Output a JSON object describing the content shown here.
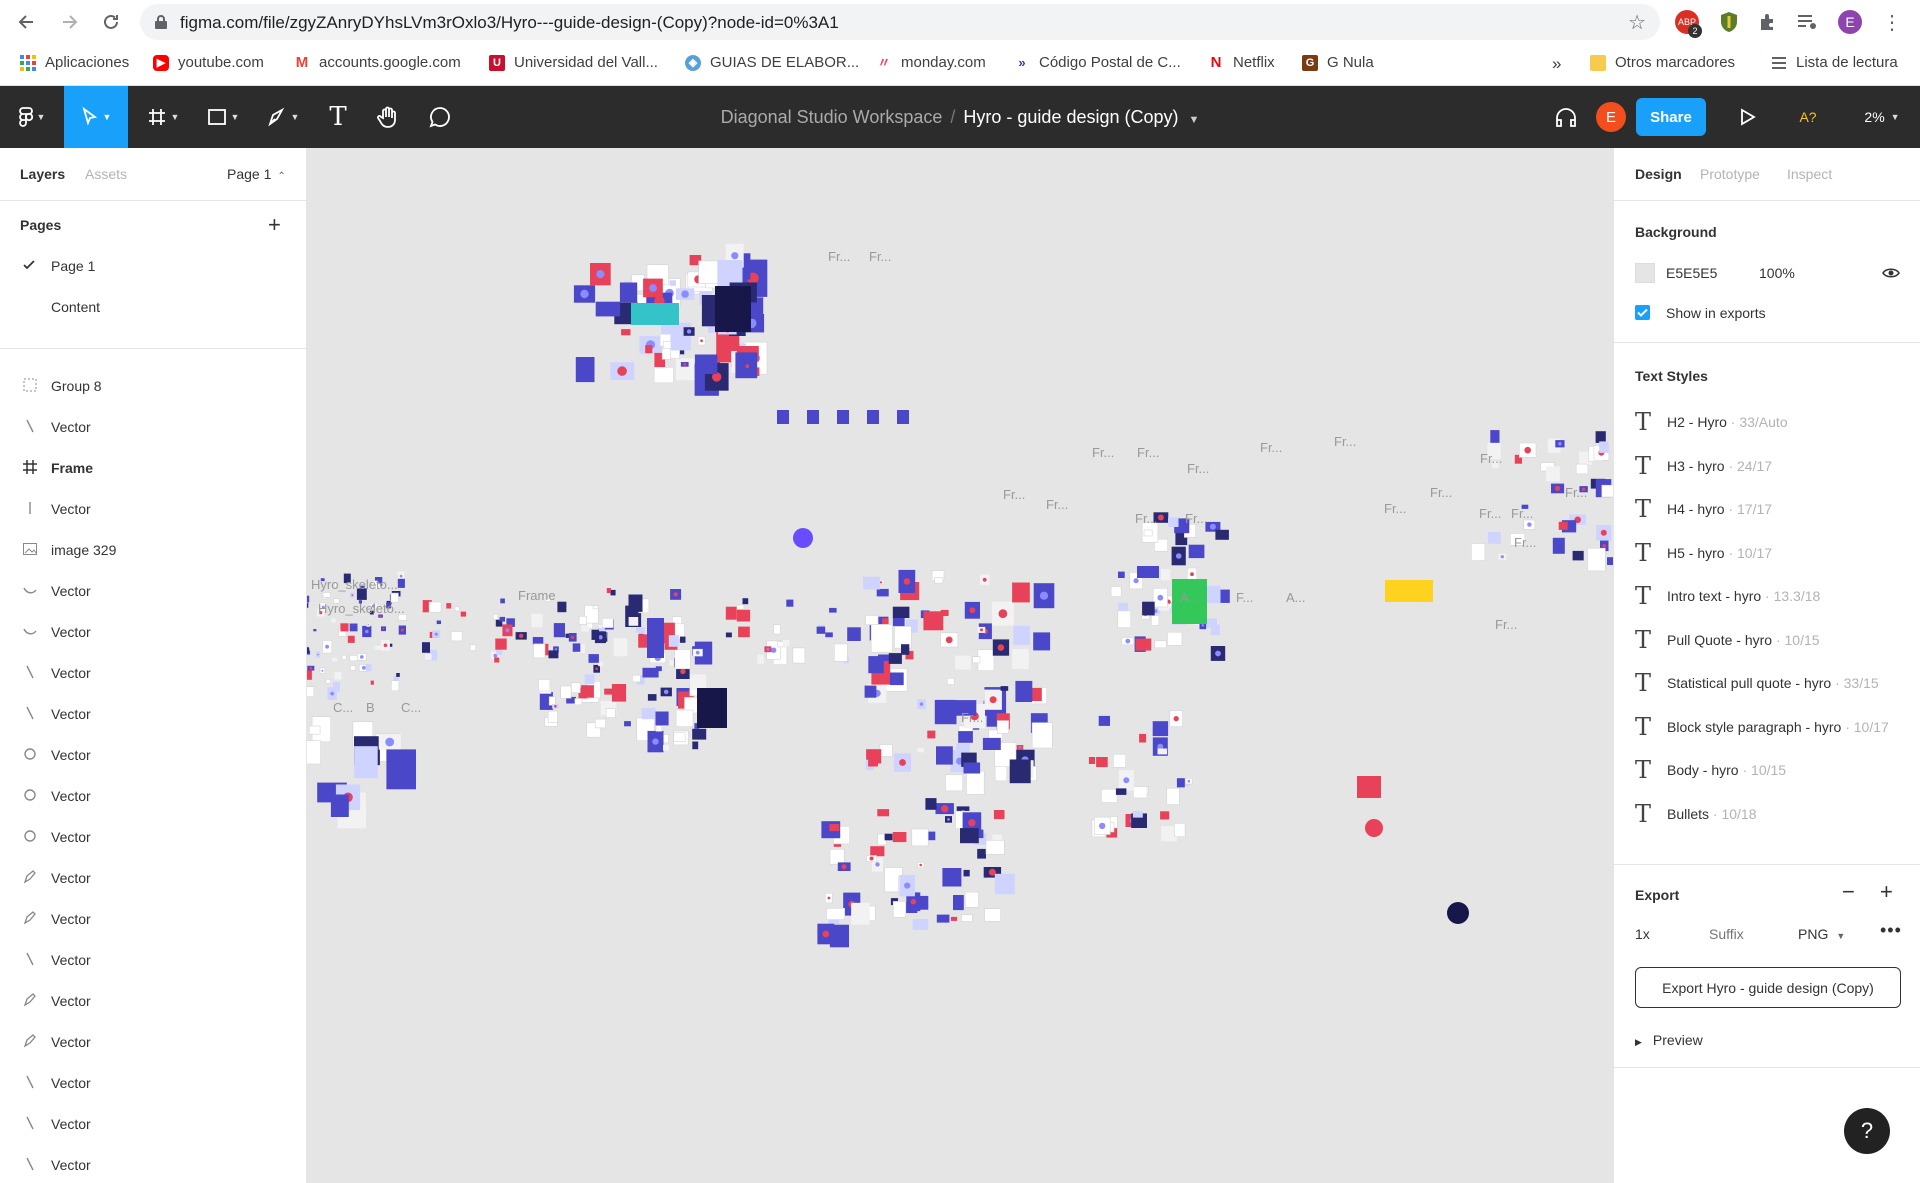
{
  "browser": {
    "url": "figma.com/file/zgyZAnryDYhsLVm3rOxlo3/Hyro---guide-design-(Copy)?node-id=0%3A1",
    "extension_badge": "ABP",
    "extension_count": "2",
    "profile_initial": "E",
    "bookmarks": [
      {
        "label": "Aplicaciones",
        "icon": "apps-grid-icon"
      },
      {
        "label": "youtube.com",
        "icon": "youtube-icon"
      },
      {
        "label": "accounts.google.com",
        "icon": "gmail-icon"
      },
      {
        "label": "Universidad del Vall...",
        "icon": "univalle-icon"
      },
      {
        "label": "GUIAS DE ELABOR...",
        "icon": "guias-icon"
      },
      {
        "label": "monday.com",
        "icon": "monday-icon"
      },
      {
        "label": "Código Postal de C...",
        "icon": "postal-icon"
      },
      {
        "label": "Netflix",
        "icon": "netflix-icon"
      },
      {
        "label": "G Nula",
        "icon": "gnula-icon"
      }
    ],
    "more_bookmarks": "»",
    "other_bookmarks": "Otros marcadores",
    "reading_list": "Lista de lectura"
  },
  "toolbar": {
    "workspace": "Diagonal Studio Workspace",
    "separator": "/",
    "file_name": "Hyro - guide design (Copy)",
    "user_initial": "E",
    "share_label": "Share",
    "font_warning": "A?",
    "zoom": "2%"
  },
  "left_panel": {
    "tabs": [
      "Layers",
      "Assets"
    ],
    "page_selector": "Page 1",
    "pages_title": "Pages",
    "pages": [
      "Page 1",
      "Content"
    ],
    "layers": [
      {
        "label": "Group 8",
        "icon": "group-icon"
      },
      {
        "label": "Vector",
        "icon": "vector-line-icon"
      },
      {
        "label": "Frame",
        "icon": "frame-icon"
      },
      {
        "label": "Vector",
        "icon": "vector-vline-icon"
      },
      {
        "label": "image 329",
        "icon": "image-icon"
      },
      {
        "label": "Vector",
        "icon": "vector-curve-icon"
      },
      {
        "label": "Vector",
        "icon": "vector-curve-icon"
      },
      {
        "label": "Vector",
        "icon": "vector-line-icon"
      },
      {
        "label": "Vector",
        "icon": "vector-line-icon"
      },
      {
        "label": "Vector",
        "icon": "vector-ellipse-icon"
      },
      {
        "label": "Vector",
        "icon": "vector-ellipse-icon"
      },
      {
        "label": "Vector",
        "icon": "vector-ellipse-icon"
      },
      {
        "label": "Vector",
        "icon": "vector-pen-icon"
      },
      {
        "label": "Vector",
        "icon": "vector-pen-icon"
      },
      {
        "label": "Vector",
        "icon": "vector-line-icon"
      },
      {
        "label": "Vector",
        "icon": "vector-pen-icon"
      },
      {
        "label": "Vector",
        "icon": "vector-pen-icon"
      },
      {
        "label": "Vector",
        "icon": "vector-line-icon"
      },
      {
        "label": "Vector",
        "icon": "vector-line-icon"
      },
      {
        "label": "Vector",
        "icon": "vector-line-icon"
      }
    ]
  },
  "canvas": {
    "background": "#E5E5E5",
    "frame_labels": [
      "Fr...",
      "Fr...",
      "Fr...",
      "Fr...",
      "Fr...",
      "Fr...",
      "Fr...",
      "Fr...",
      "Fr...",
      "Fr...",
      "Fr...",
      "Fr...",
      "Fr...",
      "Fr...",
      "Fr...",
      "Fr...",
      "Fr...",
      "Fr...",
      "Fr...",
      "Hyro_skeleto...",
      "Hyro_skeleto...",
      "Frame",
      "C...",
      "B",
      "C...",
      "A...",
      "F...",
      "A...",
      "Fr..."
    ]
  },
  "right_panel": {
    "tabs": [
      "Design",
      "Prototype",
      "Inspect"
    ],
    "background_title": "Background",
    "background_hex": "E5E5E5",
    "background_opacity": "100%",
    "show_in_exports": "Show in exports",
    "text_styles_title": "Text Styles",
    "text_styles": [
      {
        "name": "H2 - Hyro",
        "meta": "· 33/Auto"
      },
      {
        "name": "H3 - hyro",
        "meta": "· 24/17"
      },
      {
        "name": "H4 - hyro",
        "meta": "· 17/17"
      },
      {
        "name": "H5 - hyro",
        "meta": "· 10/17"
      },
      {
        "name": "Intro text - hyro",
        "meta": "· 13.3/18"
      },
      {
        "name": "Pull Quote - hyro",
        "meta": "· 10/15"
      },
      {
        "name": "Statistical pull quote - hyro",
        "meta": "· 33/15"
      },
      {
        "name": "Block style paragraph - hyro",
        "meta": "· 10/17"
      },
      {
        "name": "Body - hyro",
        "meta": "· 10/15"
      },
      {
        "name": "Bullets",
        "meta": "· 10/18"
      }
    ],
    "export_title": "Export",
    "export_scale": "1x",
    "export_suffix_placeholder": "Suffix",
    "export_format": "PNG",
    "export_button": "Export Hyro - guide design (Copy)",
    "preview": "Preview"
  },
  "help": "?",
  "colors": {
    "accent": "#18a0fb",
    "toolbar": "#2c2c2c",
    "select_tool": "#18a0fb",
    "hyro_purple": "#4a47c8",
    "hyro_pink": "#e8425a",
    "user_avatar": "#f24e1e"
  }
}
